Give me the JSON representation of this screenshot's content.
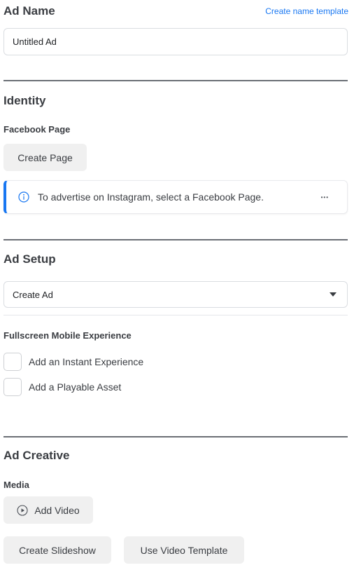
{
  "ad_name": {
    "heading": "Ad Name",
    "template_link": "Create name template",
    "input_value": "Untitled Ad"
  },
  "identity": {
    "heading": "Identity",
    "facebook_page_label": "Facebook Page",
    "create_page_button": "Create Page",
    "banner": {
      "icon": "info-icon",
      "message": "To advertise on Instagram, select a Facebook Page.",
      "more_icon": "more-options-icon",
      "more_glyph": "•••"
    }
  },
  "ad_setup": {
    "heading": "Ad Setup",
    "dropdown_value": "Create Ad",
    "fullscreen_label": "Fullscreen Mobile Experience",
    "options": [
      {
        "label": "Add an Instant Experience",
        "checked": false
      },
      {
        "label": "Add a Playable Asset",
        "checked": false
      }
    ]
  },
  "ad_creative": {
    "heading": "Ad Creative",
    "media_label": "Media",
    "add_video_button": "Add Video",
    "create_slideshow_button": "Create Slideshow",
    "use_video_template_button": "Use Video Template"
  },
  "colors": {
    "accent": "#1877f2",
    "button_bg": "#f0f0f0",
    "heading_text": "#3a3d42"
  }
}
